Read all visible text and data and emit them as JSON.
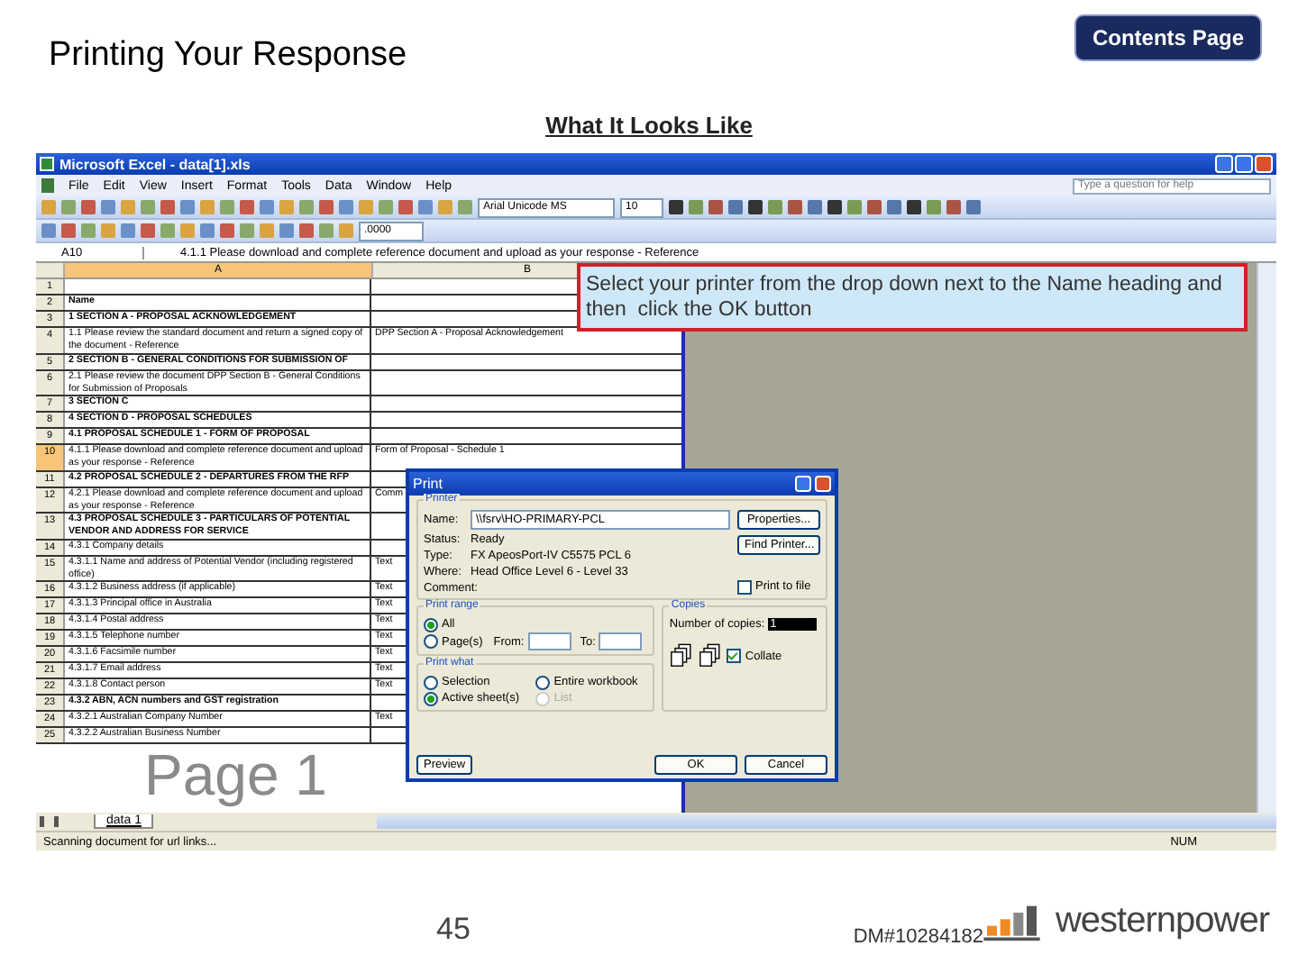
{
  "slide": {
    "title": "Printing Your Response",
    "contents_button": "Contents Page",
    "subtitle": "What It Looks Like",
    "page_number": "45",
    "doc_id": "DM#10284182",
    "logo_text": "westernpower"
  },
  "excel": {
    "title": "Microsoft Excel - data[1].xls",
    "menu": [
      "File",
      "Edit",
      "View",
      "Insert",
      "Format",
      "Tools",
      "Data",
      "Window",
      "Help"
    ],
    "help_placeholder": "Type a question for help",
    "font": "Arial Unicode MS",
    "font_size": "10",
    "number_format": ".0000",
    "name_box": "A10",
    "formula": "4.1.1 Please download and complete reference document and upload as your response - Reference",
    "columns": [
      "A",
      "B"
    ],
    "rows": [
      {
        "number": "1",
        "kind": "item",
        "selected": false
      },
      {
        "number": "2",
        "kind": "heading",
        "a": "Name",
        "selected": false
      },
      {
        "number": "3",
        "kind": "heading",
        "a": "1 SECTION A - PROPOSAL ACKNOWLEDGEMENT",
        "selected": false
      },
      {
        "number": "4",
        "kind": "item",
        "a": "1.1 Please review the standard document and return a signed copy of the document - Reference",
        "b": "DPP Section A - Proposal Acknowledgement",
        "selected": false
      },
      {
        "number": "5",
        "kind": "heading",
        "a": "2 SECTION B - GENERAL CONDITIONS FOR SUBMISSION OF",
        "selected": false
      },
      {
        "number": "6",
        "kind": "item",
        "a": "2.1 Please review the document DPP Section B - General Conditions for Submission of Proposals",
        "selected": false
      },
      {
        "number": "7",
        "kind": "heading",
        "a": "3 SECTION C",
        "selected": false
      },
      {
        "number": "8",
        "kind": "heading",
        "a": "4 SECTION D - PROPOSAL SCHEDULES",
        "selected": false
      },
      {
        "number": "9",
        "kind": "heading",
        "a": "4.1 PROPOSAL SCHEDULE 1 - FORM OF PROPOSAL",
        "selected": false
      },
      {
        "number": "10",
        "kind": "item",
        "a": "4.1.1 Please download and complete reference document and upload as your response - Reference",
        "b": "Form of Proposal - Schedule 1",
        "selected": true
      },
      {
        "number": "11",
        "kind": "heading",
        "a": "4.2 PROPOSAL SCHEDULE 2 - DEPARTURES FROM THE RFP",
        "selected": false
      },
      {
        "number": "12",
        "kind": "item",
        "a": "4.2.1 Please download and complete reference document and upload as your response - Reference",
        "b": "Comm",
        "selected": false
      },
      {
        "number": "13",
        "kind": "heading",
        "a": "4.3 PROPOSAL SCHEDULE 3 - PARTICULARS OF POTENTIAL VENDOR AND ADDRESS FOR SERVICE",
        "selected": false
      },
      {
        "number": "14",
        "kind": "item",
        "a": "4.3.1 Company details",
        "selected": false
      },
      {
        "number": "15",
        "kind": "item",
        "a": "4.3.1.1 Name and address of Potential Vendor (including registered office)",
        "b": "Text",
        "selected": false
      },
      {
        "number": "16",
        "kind": "item",
        "a": "4.3.1.2 Business address (if applicable)",
        "b": "Text",
        "selected": false
      },
      {
        "number": "17",
        "kind": "item",
        "a": "4.3.1.3 Principal office in Australia",
        "b": "Text",
        "selected": false
      },
      {
        "number": "18",
        "kind": "item",
        "a": "4.3.1.4 Postal address",
        "b": "Text",
        "selected": false
      },
      {
        "number": "19",
        "kind": "item",
        "a": "4.3.1.5 Telephone number",
        "b": "Text",
        "selected": false
      },
      {
        "number": "20",
        "kind": "item",
        "a": "4.3.1.6 Facsimile number",
        "b": "Text",
        "selected": false
      },
      {
        "number": "21",
        "kind": "item",
        "a": "4.3.1.7 Email address",
        "b": "Text",
        "selected": false
      },
      {
        "number": "22",
        "kind": "item",
        "a": "4.3.1.8 Contact person",
        "b": "Text",
        "selected": false
      },
      {
        "number": "23",
        "kind": "heading",
        "a": "4.3.2 ABN, ACN numbers and GST registration",
        "selected": false
      },
      {
        "number": "24",
        "kind": "item",
        "a": "4.3.2.1 Australian Company Number",
        "b": "Text",
        "selected": false
      },
      {
        "number": "25",
        "kind": "item",
        "a": "4.3.2.2 Australian Business Number",
        "selected": false
      }
    ],
    "watermark": "Page 1",
    "sheet_tab": "data 1",
    "status": "Scanning document for url links...",
    "status_num": "NUM"
  },
  "callout": "Select your printer from the drop down next to the Name heading and then  click the OK button",
  "print_dialog": {
    "title": "Print",
    "printer_group": "Printer",
    "name_label": "Name:",
    "name_value": "\\\\fsrv\\HO-PRIMARY-PCL",
    "fields": [
      {
        "label": "Status:",
        "value": "Ready"
      },
      {
        "label": "Type:",
        "value": "FX ApeosPort-IV C5575 PCL 6"
      },
      {
        "label": "Where:",
        "value": "Head Office Level 6 - Level 33"
      },
      {
        "label": "Comment:"
      }
    ],
    "properties_button": "Properties...",
    "find_button": "Find Printer...",
    "print_to_file": {
      "label": "Print to file",
      "checked": false
    },
    "range_group": "Print range",
    "range_options": [
      {
        "label": "All",
        "selected": true
      },
      {
        "label": "Page(s)",
        "selected": false
      }
    ],
    "from_label": "From:",
    "to_label": "To:",
    "what_group": "Print what",
    "what_options": [
      {
        "label": "Selection",
        "selected": false,
        "disabled": false
      },
      {
        "label": "Entire workbook",
        "selected": false,
        "disabled": false
      },
      {
        "label": "Active sheet(s)",
        "selected": true,
        "disabled": false
      },
      {
        "label": "List",
        "selected": false,
        "disabled": true
      }
    ],
    "copies_group": "Copies",
    "copies_label": "Number of copies:",
    "copies_value": "1",
    "collate": {
      "label": "Collate",
      "checked": true
    },
    "preview_button": "Preview",
    "ok_button": "OK",
    "cancel_button": "Cancel"
  }
}
